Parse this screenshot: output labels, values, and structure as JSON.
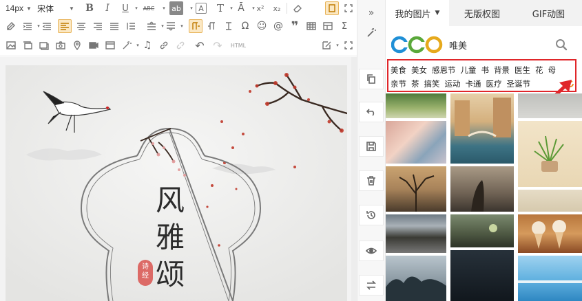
{
  "toolbar": {
    "font_size": "14px",
    "font_family": "宋体",
    "html_label": "HTML"
  },
  "poster": {
    "title_chars": [
      "风",
      "雅",
      "颂"
    ],
    "seal_text": "诗经"
  },
  "panel": {
    "tabs": [
      {
        "label": "我的图片",
        "has_caret": true
      },
      {
        "label": "无版权图",
        "has_caret": false
      },
      {
        "label": "GIF动图",
        "has_caret": false
      }
    ],
    "search": {
      "value": "唯美",
      "logo_text": "CCO"
    },
    "tags_row1": [
      "美食",
      "美女",
      "感恩节",
      "儿童",
      "书",
      "背景",
      "医生",
      "花",
      "母"
    ],
    "tags_row2": [
      "亲节",
      "茶",
      "搞笑",
      "运动",
      "卡通",
      "医疗",
      "圣诞节"
    ]
  },
  "colors": {
    "highlight_border": "#e0262a",
    "accent_orange": "#f08a1c",
    "toolbar_active": "#fbe8c4"
  }
}
